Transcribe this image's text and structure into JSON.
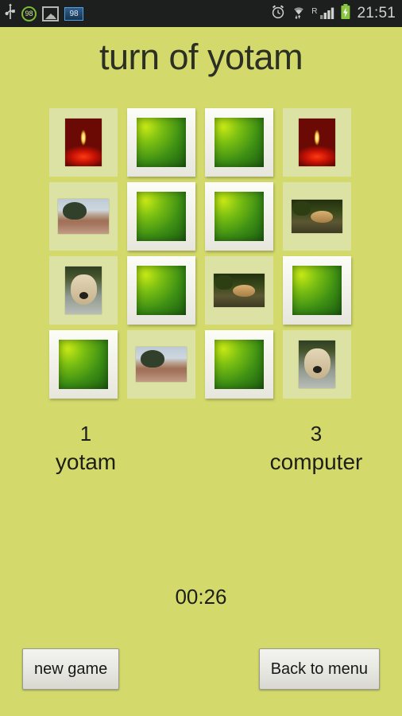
{
  "statusbar": {
    "time": "21:51",
    "left_icons": [
      {
        "name": "usb-icon",
        "label": "USB"
      },
      {
        "name": "battery-percent-badge-icon",
        "label": "98"
      },
      {
        "name": "screenshot-photo-icon",
        "label": "Screenshot"
      },
      {
        "name": "notification-count-badge-icon",
        "label": "98"
      }
    ],
    "right_icons": [
      {
        "name": "alarm-clock-icon",
        "label": "Alarm"
      },
      {
        "name": "wifi-icon",
        "label": "Wi-Fi"
      },
      {
        "name": "roaming-indicator",
        "label": "R"
      },
      {
        "name": "signal-bars-icon",
        "label": "Signal"
      },
      {
        "name": "battery-charging-icon",
        "label": "Charging"
      }
    ]
  },
  "header": {
    "title": "turn of yotam"
  },
  "board": {
    "rows": 4,
    "columns": 4,
    "cards": [
      {
        "state": "matched",
        "image": "candle"
      },
      {
        "state": "facedown",
        "image": ""
      },
      {
        "state": "facedown",
        "image": ""
      },
      {
        "state": "matched",
        "image": "candle"
      },
      {
        "state": "matched",
        "image": "river"
      },
      {
        "state": "facedown",
        "image": ""
      },
      {
        "state": "facedown",
        "image": ""
      },
      {
        "state": "matched",
        "image": "hyrax"
      },
      {
        "state": "matched",
        "image": "dog"
      },
      {
        "state": "facedown",
        "image": ""
      },
      {
        "state": "matched",
        "image": "hyrax"
      },
      {
        "state": "facedown",
        "image": ""
      },
      {
        "state": "facedown",
        "image": ""
      },
      {
        "state": "matched",
        "image": "river"
      },
      {
        "state": "facedown",
        "image": ""
      },
      {
        "state": "matched",
        "image": "dog"
      }
    ]
  },
  "scoreboard": {
    "player": {
      "score": "1",
      "name": "yotam"
    },
    "opponent": {
      "score": "3",
      "name": "computer"
    }
  },
  "timer": {
    "elapsed": "00:26"
  },
  "actions": {
    "new_game_label": "new game",
    "back_to_menu_label": "Back to menu"
  },
  "colors": {
    "background": "#d3da6b",
    "matched_card": "#dbe2a4",
    "facedown_frame": "#f4f4ee",
    "status_bar": "#1d1f1e",
    "text": "#1d1f18"
  }
}
